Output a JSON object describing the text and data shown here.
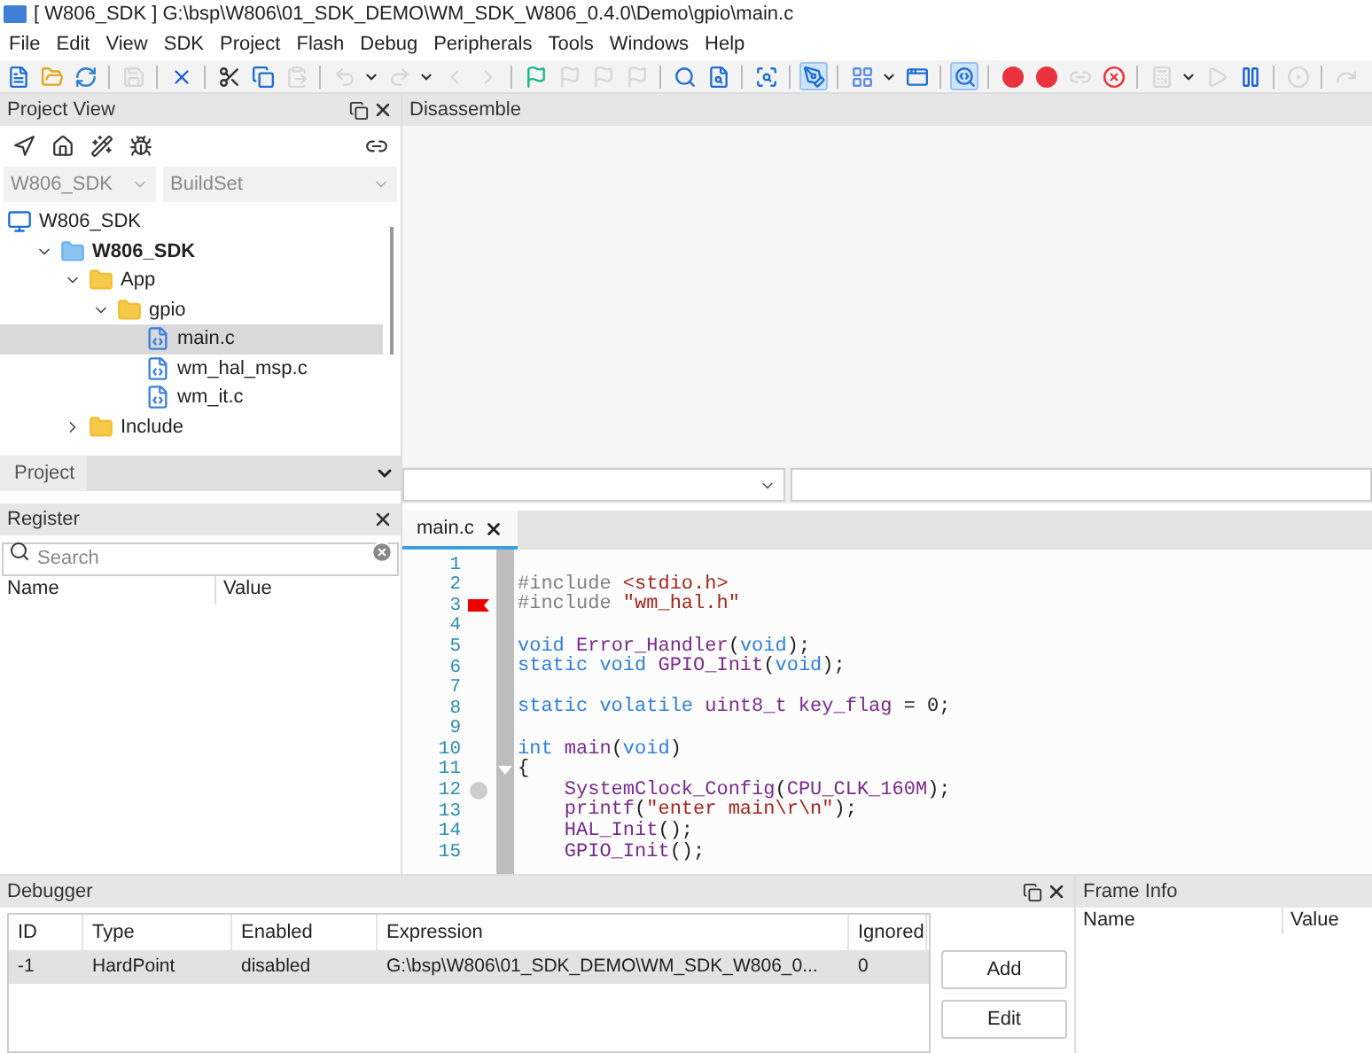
{
  "window": {
    "title": "[ W806_SDK ] G:\\bsp\\W806\\01_SDK_DEMO\\WM_SDK_W806_0.4.0\\Demo\\gpio\\main.c"
  },
  "menu": [
    "File",
    "Edit",
    "View",
    "SDK",
    "Project",
    "Flash",
    "Debug",
    "Peripherals",
    "Tools",
    "Windows",
    "Help"
  ],
  "toolbar": [
    {
      "kind": "new",
      "disabled": false,
      "pressed": false
    },
    {
      "kind": "open",
      "disabled": false,
      "pressed": false
    },
    {
      "kind": "reload",
      "disabled": false,
      "pressed": false
    },
    {
      "kind": "separator"
    },
    {
      "kind": "save",
      "disabled": true,
      "pressed": false
    },
    {
      "kind": "separator"
    },
    {
      "kind": "close",
      "disabled": false,
      "pressed": false
    },
    {
      "kind": "separator"
    },
    {
      "kind": "cut",
      "disabled": false,
      "pressed": false
    },
    {
      "kind": "copy",
      "disabled": false,
      "pressed": false
    },
    {
      "kind": "paste",
      "disabled": true,
      "pressed": false
    },
    {
      "kind": "separator"
    },
    {
      "kind": "undo",
      "disabled": true,
      "pressed": false
    },
    {
      "kind": "dropdown"
    },
    {
      "kind": "redo",
      "disabled": true,
      "pressed": false
    },
    {
      "kind": "dropdown"
    },
    {
      "kind": "back",
      "disabled": true,
      "pressed": false
    },
    {
      "kind": "forward",
      "disabled": true,
      "pressed": false
    },
    {
      "kind": "separator"
    },
    {
      "kind": "bookmark",
      "disabled": false,
      "pressed": false
    },
    {
      "kind": "bookmark",
      "disabled": true,
      "pressed": false
    },
    {
      "kind": "bookmark",
      "disabled": true,
      "pressed": false
    },
    {
      "kind": "bookmark",
      "disabled": true,
      "pressed": false
    },
    {
      "kind": "separator"
    },
    {
      "kind": "find",
      "disabled": false,
      "pressed": false
    },
    {
      "kind": "findfile",
      "disabled": false,
      "pressed": false
    },
    {
      "kind": "separator"
    },
    {
      "kind": "findwindow",
      "disabled": false,
      "pressed": false
    },
    {
      "kind": "separator"
    },
    {
      "kind": "edit",
      "disabled": false,
      "pressed": true
    },
    {
      "kind": "separator"
    },
    {
      "kind": "grid",
      "disabled": false,
      "pressed": false
    },
    {
      "kind": "dropdown"
    },
    {
      "kind": "window",
      "disabled": false,
      "pressed": false
    },
    {
      "kind": "separator"
    },
    {
      "kind": "debug",
      "disabled": false,
      "pressed": true
    },
    {
      "kind": "separator"
    },
    {
      "kind": "breakpoint",
      "disabled": false,
      "pressed": false
    },
    {
      "kind": "breakpoints",
      "disabled": false,
      "pressed": false
    },
    {
      "kind": "link",
      "disabled": true,
      "pressed": false
    },
    {
      "kind": "clearbreak",
      "disabled": false,
      "pressed": false
    },
    {
      "kind": "separator"
    },
    {
      "kind": "calc",
      "disabled": true,
      "pressed": false
    },
    {
      "kind": "dropdown"
    },
    {
      "kind": "run",
      "disabled": true,
      "pressed": false
    },
    {
      "kind": "pause",
      "disabled": false,
      "pressed": false
    },
    {
      "kind": "separator"
    },
    {
      "kind": "stop",
      "disabled": true,
      "pressed": false
    },
    {
      "kind": "separator"
    },
    {
      "kind": "step",
      "disabled": true,
      "pressed": false
    }
  ],
  "project_view": {
    "title": "Project View",
    "tools": [
      {
        "kind": "locate"
      },
      {
        "kind": "home"
      },
      {
        "kind": "wand"
      },
      {
        "kind": "bug"
      },
      {
        "kind": "link"
      }
    ],
    "project_combo": {
      "value": "W806_SDK"
    },
    "buildset_combo": {
      "value": "BuildSet"
    },
    "tree": [
      {
        "label": "W806_SDK",
        "kind": "workspace",
        "bold": false,
        "selected": false,
        "children": [
          {
            "label": "W806_SDK",
            "kind": "project",
            "bold": true,
            "expanded": true,
            "selected": false,
            "children": [
              {
                "label": "App",
                "kind": "folder",
                "bold": false,
                "expanded": true,
                "selected": false,
                "children": [
                  {
                    "label": "gpio",
                    "kind": "folder",
                    "bold": false,
                    "expanded": true,
                    "selected": false,
                    "children": [
                      {
                        "label": "main.c",
                        "kind": "file",
                        "bold": false,
                        "expanded": false,
                        "selected": true
                      },
                      {
                        "label": "wm_hal_msp.c",
                        "kind": "file",
                        "bold": false,
                        "expanded": false,
                        "selected": false
                      },
                      {
                        "label": "wm_it.c",
                        "kind": "file",
                        "bold": false,
                        "expanded": false,
                        "selected": false
                      }
                    ]
                  }
                ]
              },
              {
                "label": "Include",
                "kind": "folder",
                "bold": false,
                "expanded": false,
                "selected": false
              }
            ]
          }
        ]
      }
    ],
    "tab": {
      "label": "Project"
    }
  },
  "register": {
    "title": "Register",
    "search": {
      "placeholder": "Search"
    },
    "columns": [
      "Name",
      "Value"
    ]
  },
  "disassemble": {
    "title": "Disassemble"
  },
  "editor": {
    "tabs": [
      {
        "label": "main.c",
        "selected": true
      }
    ],
    "lines": [
      {
        "number": "1",
        "bookmark": false,
        "marker": false,
        "fold": false
      },
      {
        "number": "2",
        "bookmark": false,
        "marker": false,
        "fold": false,
        "tokens": [
          {
            "text": "#include ",
            "kind": "pre"
          },
          {
            "text": "<stdio.h>",
            "kind": "str"
          }
        ]
      },
      {
        "number": "3",
        "bookmark": true,
        "marker": false,
        "fold": false,
        "tokens": [
          {
            "text": "#include ",
            "kind": "pre"
          },
          {
            "text": "\"wm_hal.h\"",
            "kind": "str"
          }
        ]
      },
      {
        "number": "4",
        "bookmark": false,
        "marker": false,
        "fold": false
      },
      {
        "number": "5",
        "bookmark": false,
        "marker": false,
        "fold": false,
        "tokens": [
          {
            "text": "void ",
            "kind": "kw"
          },
          {
            "text": "Error_Handler",
            "kind": "id"
          },
          {
            "text": "(",
            "kind": "plain"
          },
          {
            "text": "void",
            "kind": "kw"
          },
          {
            "text": ");",
            "kind": "plain"
          }
        ]
      },
      {
        "number": "6",
        "bookmark": false,
        "marker": false,
        "fold": false,
        "tokens": [
          {
            "text": "static void ",
            "kind": "kw"
          },
          {
            "text": "GPIO_Init",
            "kind": "id"
          },
          {
            "text": "(",
            "kind": "plain"
          },
          {
            "text": "void",
            "kind": "kw"
          },
          {
            "text": ");",
            "kind": "plain"
          }
        ]
      },
      {
        "number": "7",
        "bookmark": false,
        "marker": false,
        "fold": false
      },
      {
        "number": "8",
        "bookmark": false,
        "marker": false,
        "fold": false,
        "tokens": [
          {
            "text": "static volatile ",
            "kind": "kw"
          },
          {
            "text": "uint8_t key_flag",
            "kind": "id"
          },
          {
            "text": " = 0;",
            "kind": "plain"
          }
        ]
      },
      {
        "number": "9",
        "bookmark": false,
        "marker": false,
        "fold": false
      },
      {
        "number": "10",
        "bookmark": false,
        "marker": false,
        "fold": false,
        "tokens": [
          {
            "text": "int ",
            "kind": "kw"
          },
          {
            "text": "main",
            "kind": "id"
          },
          {
            "text": "(",
            "kind": "plain"
          },
          {
            "text": "void",
            "kind": "kw"
          },
          {
            "text": ")",
            "kind": "plain"
          }
        ]
      },
      {
        "number": "11",
        "bookmark": false,
        "marker": false,
        "fold": true,
        "tokens": [
          {
            "text": "{",
            "kind": "plain"
          }
        ]
      },
      {
        "number": "12",
        "bookmark": false,
        "marker": true,
        "fold": false,
        "tokens": [
          {
            "text": "    SystemClock_Config",
            "kind": "id"
          },
          {
            "text": "(",
            "kind": "plain"
          },
          {
            "text": "CPU_CLK_160M",
            "kind": "id"
          },
          {
            "text": ");",
            "kind": "plain"
          }
        ]
      },
      {
        "number": "13",
        "bookmark": false,
        "marker": false,
        "fold": false,
        "tokens": [
          {
            "text": "    printf",
            "kind": "id"
          },
          {
            "text": "(",
            "kind": "plain"
          },
          {
            "text": "\"enter main\\r\\n\"",
            "kind": "str"
          },
          {
            "text": ");",
            "kind": "plain"
          }
        ]
      },
      {
        "number": "14",
        "bookmark": false,
        "marker": false,
        "fold": false,
        "tokens": [
          {
            "text": "    HAL_Init",
            "kind": "id"
          },
          {
            "text": "();",
            "kind": "plain"
          }
        ]
      },
      {
        "number": "15",
        "bookmark": false,
        "marker": false,
        "fold": false,
        "tokens": [
          {
            "text": "    GPIO_Init",
            "kind": "id"
          },
          {
            "text": "();",
            "kind": "plain"
          }
        ]
      }
    ]
  },
  "debugger": {
    "title": "Debugger",
    "columns": [
      "ID",
      "Type",
      "Enabled",
      "Expression",
      "Ignored"
    ],
    "rows": [
      {
        "selected": true,
        "cells": [
          "-1",
          "HardPoint",
          "disabled",
          "G:\\bsp\\W806\\01_SDK_DEMO\\WM_SDK_W806_0...",
          "0"
        ]
      }
    ],
    "buttons": [
      "Add",
      "Edit"
    ]
  },
  "frame_info": {
    "title": "Frame Info",
    "columns": [
      "Name",
      "Value"
    ]
  }
}
